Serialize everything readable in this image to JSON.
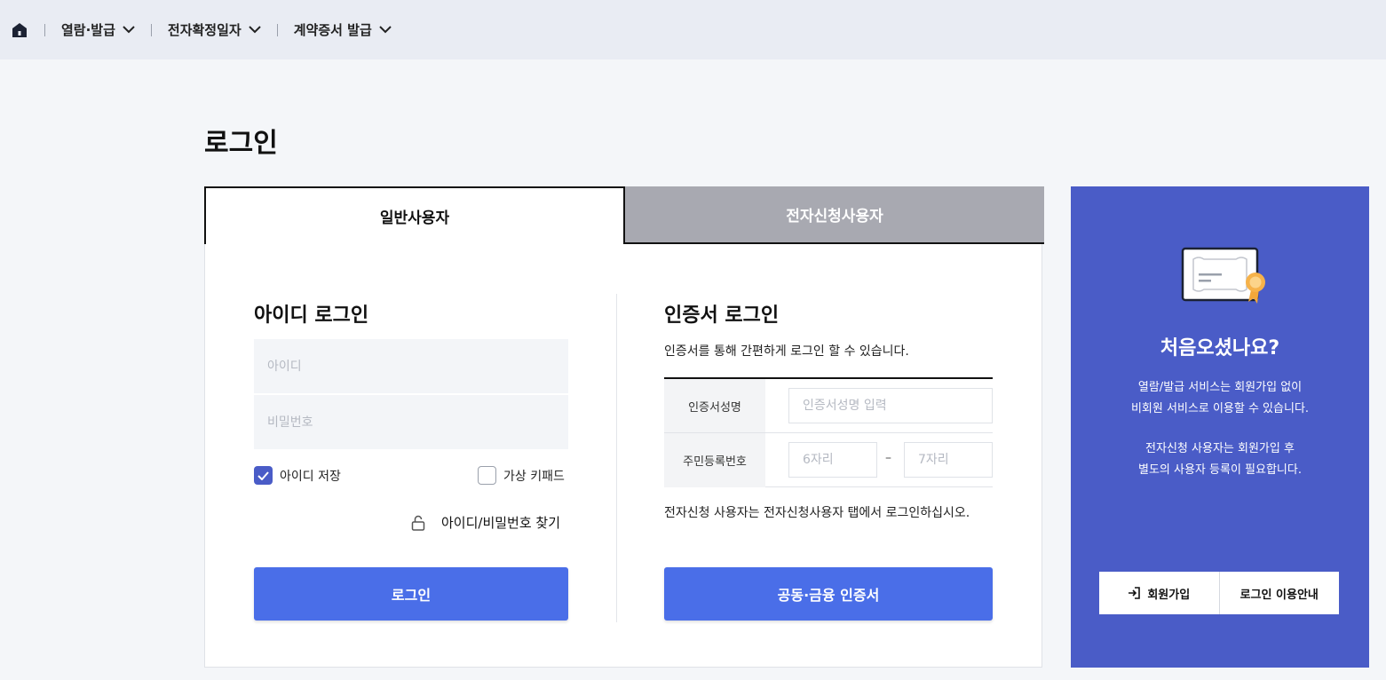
{
  "nav": {
    "items": [
      {
        "label": "열람·발급"
      },
      {
        "label": "전자확정일자"
      },
      {
        "label": "계약증서 발급"
      }
    ]
  },
  "page": {
    "title": "로그인"
  },
  "tabs": {
    "general": "일반사용자",
    "electronic": "전자신청사용자"
  },
  "id_login": {
    "title": "아이디 로그인",
    "id_placeholder": "아이디",
    "pw_placeholder": "비밀번호",
    "save_id_label": "아이디 저장",
    "save_id_checked": true,
    "virtual_keypad_label": "가상 키패드",
    "virtual_keypad_checked": false,
    "find_label": "아이디/비밀번호 찾기",
    "login_button": "로그인"
  },
  "cert_login": {
    "title": "인증서 로그인",
    "description": "인증서를 통해 간편하게 로그인 할 수 있습니다.",
    "name_label": "인증서성명",
    "name_placeholder": "인증서성명 입력",
    "rrn_label": "주민등록번호",
    "rrn_front_placeholder": "6자리",
    "rrn_dash": "–",
    "rrn_back_placeholder": "7자리",
    "note": "전자신청 사용자는 전자신청사용자 탭에서 로그인하십시오.",
    "button": "공동·금융 인증서"
  },
  "promo": {
    "title": "처음오셨나요?",
    "text1_line1": "열람/발급 서비스는 회원가입 없이",
    "text1_line2": "비회원 서비스로 이용할 수 있습니다.",
    "text2_line1": "전자신청 사용자는 회원가입 후",
    "text2_line2": "별도의 사용자 등록이 필요합니다.",
    "signup_button": "회원가입",
    "guide_button": "로그인 이용안내"
  },
  "colors": {
    "primary": "#4a6ee8",
    "promo_bg": "#4a5cc7",
    "tab_inactive": "#a8a9b1",
    "nav_bg": "#e9ecf3"
  }
}
